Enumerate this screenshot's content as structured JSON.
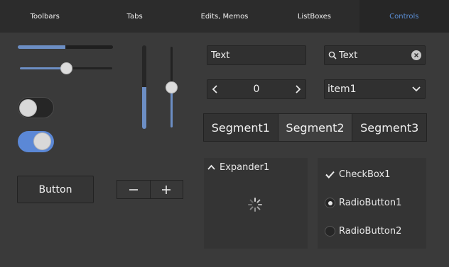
{
  "tabs": [
    {
      "label": "Toolbars",
      "active": false
    },
    {
      "label": "Tabs",
      "active": false
    },
    {
      "label": "Edits, Memos",
      "active": false
    },
    {
      "label": "ListBoxes",
      "active": false
    },
    {
      "label": "Controls",
      "active": true
    }
  ],
  "accent_color": "#5b88d6",
  "progress": {
    "value": 0.5
  },
  "hslider": {
    "value": 0.5
  },
  "toggles": [
    {
      "on": false
    },
    {
      "on": true
    }
  ],
  "button": {
    "label": "Button"
  },
  "vprogress": {
    "value": 0.5
  },
  "vslider": {
    "value": 0.5
  },
  "edit": {
    "value": "Text"
  },
  "search": {
    "value": "Text",
    "icon": "search-icon"
  },
  "numberbox": {
    "value": "0"
  },
  "combo": {
    "selected": "item1"
  },
  "segments": [
    {
      "label": "Segment1",
      "selected": false
    },
    {
      "label": "Segment2",
      "selected": true
    },
    {
      "label": "Segment3",
      "selected": false
    }
  ],
  "expander": {
    "label": "Expander1",
    "expanded": true
  },
  "checkbox": {
    "label": "CheckBox1",
    "checked": true
  },
  "radios": [
    {
      "label": "RadioButton1",
      "checked": true
    },
    {
      "label": "RadioButton2",
      "checked": false
    }
  ]
}
